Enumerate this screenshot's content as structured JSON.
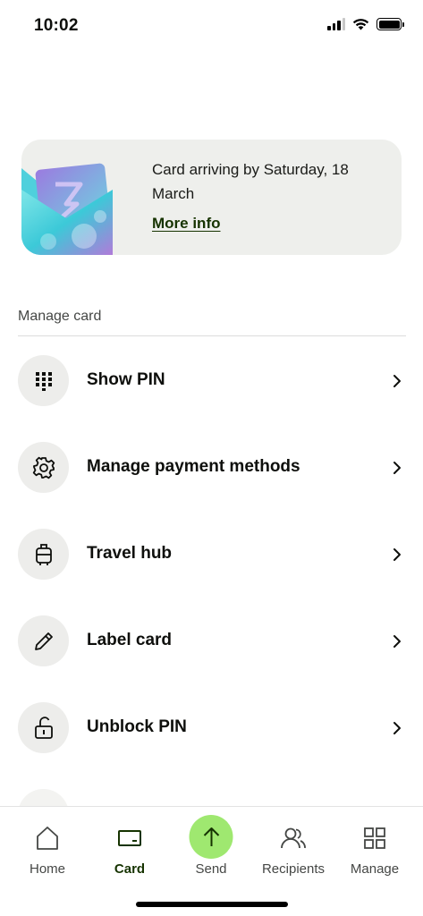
{
  "status_bar": {
    "time": "10:02",
    "icons": [
      "cellular-signal-icon",
      "wifi-icon",
      "battery-icon"
    ]
  },
  "card_banner": {
    "text": "Card arriving by Saturday, 18 March",
    "link_label": "More info",
    "image": "wise-card-envelope-image"
  },
  "manage_card": {
    "title": "Manage card",
    "items": [
      {
        "label": "Show PIN",
        "icon": "keypad-icon"
      },
      {
        "label": "Manage payment methods",
        "icon": "gear-icon"
      },
      {
        "label": "Travel hub",
        "icon": "luggage-icon"
      },
      {
        "label": "Label card",
        "icon": "pencil-icon"
      },
      {
        "label": "Unblock PIN",
        "icon": "unlock-icon"
      }
    ]
  },
  "tab_bar": {
    "tabs": [
      {
        "label": "Home",
        "icon": "home-icon"
      },
      {
        "label": "Card",
        "icon": "card-icon",
        "active": true
      },
      {
        "label": "Send",
        "icon": "send-arrow-icon"
      },
      {
        "label": "Recipients",
        "icon": "recipients-icon"
      },
      {
        "label": "Manage",
        "icon": "grid-icon"
      }
    ]
  },
  "colors": {
    "brand_green": "#9fe870",
    "forest_green": "#163300",
    "banner_bg": "#eeefec",
    "icon_bg": "#ededeb"
  }
}
